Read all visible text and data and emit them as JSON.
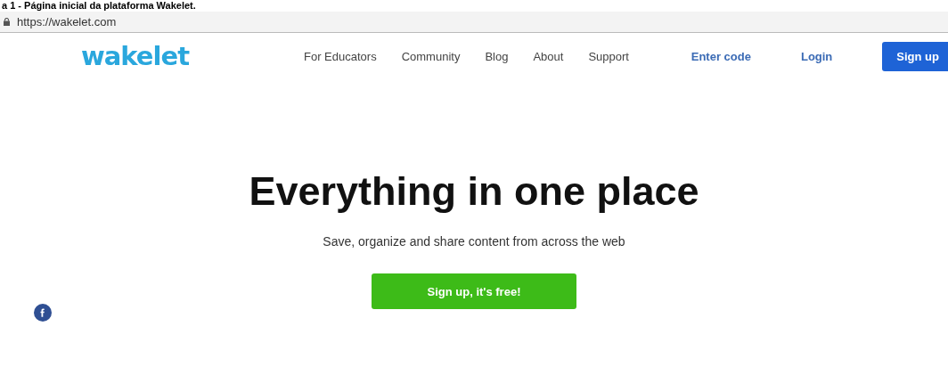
{
  "caption": "a 1 - Página inicial da plataforma Wakelet.",
  "address_bar": {
    "url": "https://wakelet.com"
  },
  "logo": "wakelet",
  "nav": [
    "For Educators",
    "Community",
    "Blog",
    "About",
    "Support"
  ],
  "actions": [
    {
      "label": "Enter code",
      "kind": "link"
    },
    {
      "label": "Login",
      "kind": "link"
    },
    {
      "label": "Sign up",
      "kind": "button"
    }
  ],
  "hero": {
    "title": "Everything in one place",
    "subtitle": "Save, organize and share content from across the web",
    "cta": "Sign up, it's free!"
  }
}
